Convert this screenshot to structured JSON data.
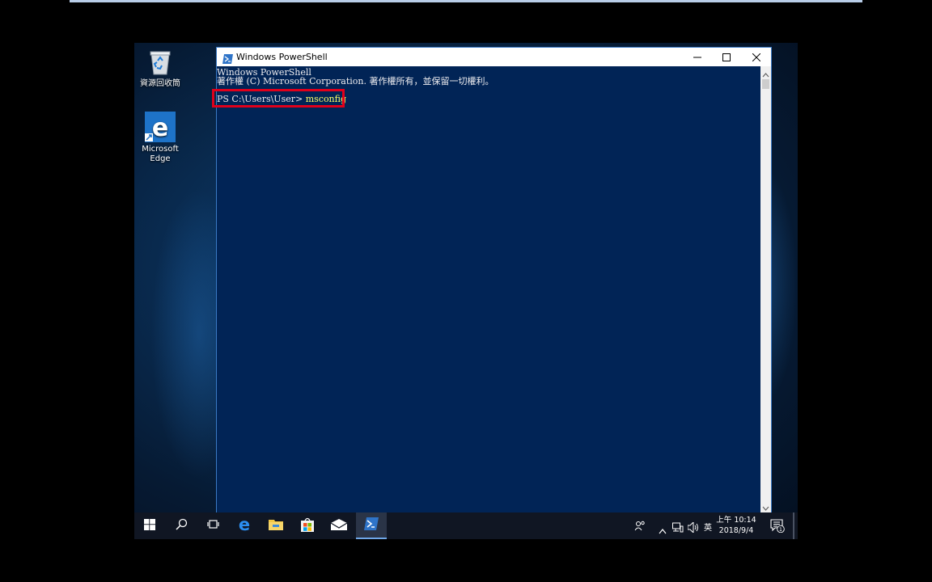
{
  "desktop": {
    "icons": [
      {
        "label": "資源回收筒",
        "icon": "recycle-bin-icon"
      },
      {
        "label": "Microsoft Edge",
        "icon": "edge-icon"
      }
    ]
  },
  "window": {
    "title": "Windows PowerShell",
    "icon": "powershell-icon",
    "buttons": {
      "minimize": "minimize-icon",
      "maximize": "maximize-icon",
      "close": "close-icon"
    }
  },
  "console": {
    "line1": "Windows PowerShell",
    "line2": "著作權 (C) Microsoft Corporation. 著作權所有，並保留一切權利。",
    "prompt": "PS C:\\Users\\User> ",
    "command": "msconfig",
    "colors": {
      "background": "#012456",
      "text": "#eeedf0",
      "command": "#ffff66",
      "highlight": "#e0001b"
    }
  },
  "taskbar": {
    "items": [
      "start-icon",
      "search-icon",
      "task-view-icon",
      "edge-icon",
      "file-explorer-icon",
      "store-icon",
      "mail-icon",
      "powershell-icon"
    ],
    "tray": {
      "ime": "英",
      "time": "上午 10:14",
      "date": "2018/9/4",
      "notification_count": "1"
    }
  }
}
